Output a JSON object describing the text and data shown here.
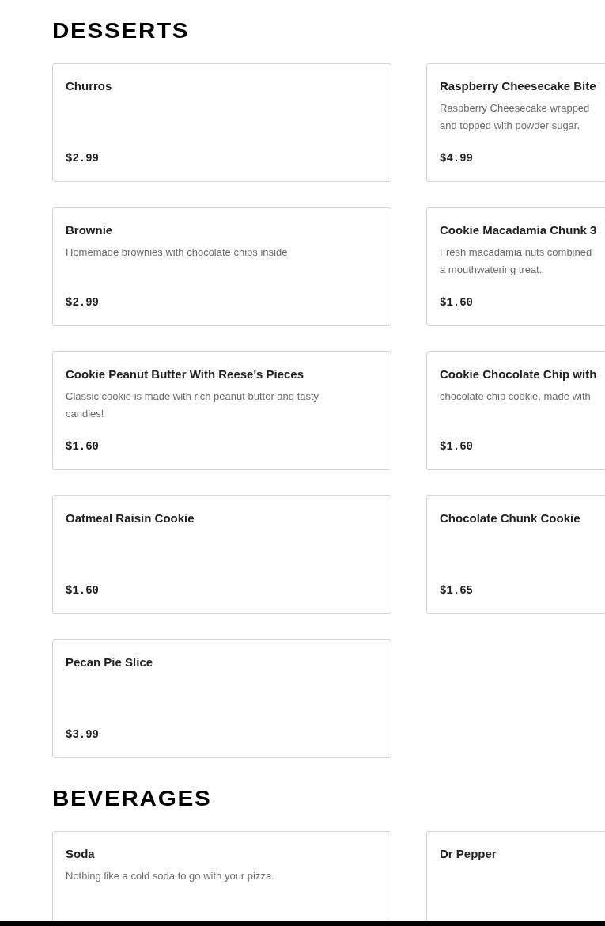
{
  "sections": [
    {
      "title": "DESSERTS",
      "items": [
        {
          "name": "Churros",
          "price": "$2.99"
        },
        {
          "name": "Raspberry Cheesecake Bite",
          "description_lines": [
            "Raspberry Cheesecake wrapped",
            "and topped with powder sugar."
          ],
          "price": "$4.99"
        },
        {
          "name": "Brownie",
          "description_lines": [
            "Homemade brownies with chocolate chips inside"
          ],
          "price": "$2.99"
        },
        {
          "name": "Cookie Macadamia Chunk 3",
          "description_lines": [
            "Fresh macadamia nuts combined",
            "a mouthwatering treat."
          ],
          "price": "$1.60"
        },
        {
          "name": "Cookie Peanut Butter With Reese's Pieces",
          "description_lines": [
            "Classic cookie is made with rich peanut butter and tasty",
            "candies!"
          ],
          "price": "$1.60"
        },
        {
          "name": "Cookie Chocolate Chip with",
          "description_lines": [
            "chocolate chip cookie, made with"
          ],
          "price": "$1.60"
        },
        {
          "name": "Oatmeal Raisin Cookie",
          "price": "$1.60"
        },
        {
          "name": "Chocolate Chunk Cookie",
          "price": "$1.65"
        },
        {
          "name": "Pecan Pie Slice",
          "price": "$3.99"
        }
      ]
    },
    {
      "title": "BEVERAGES",
      "items": [
        {
          "name": "Soda",
          "description_lines": [
            "Nothing like a cold soda to go with your pizza."
          ]
        },
        {
          "name": "Dr Pepper"
        }
      ]
    }
  ]
}
